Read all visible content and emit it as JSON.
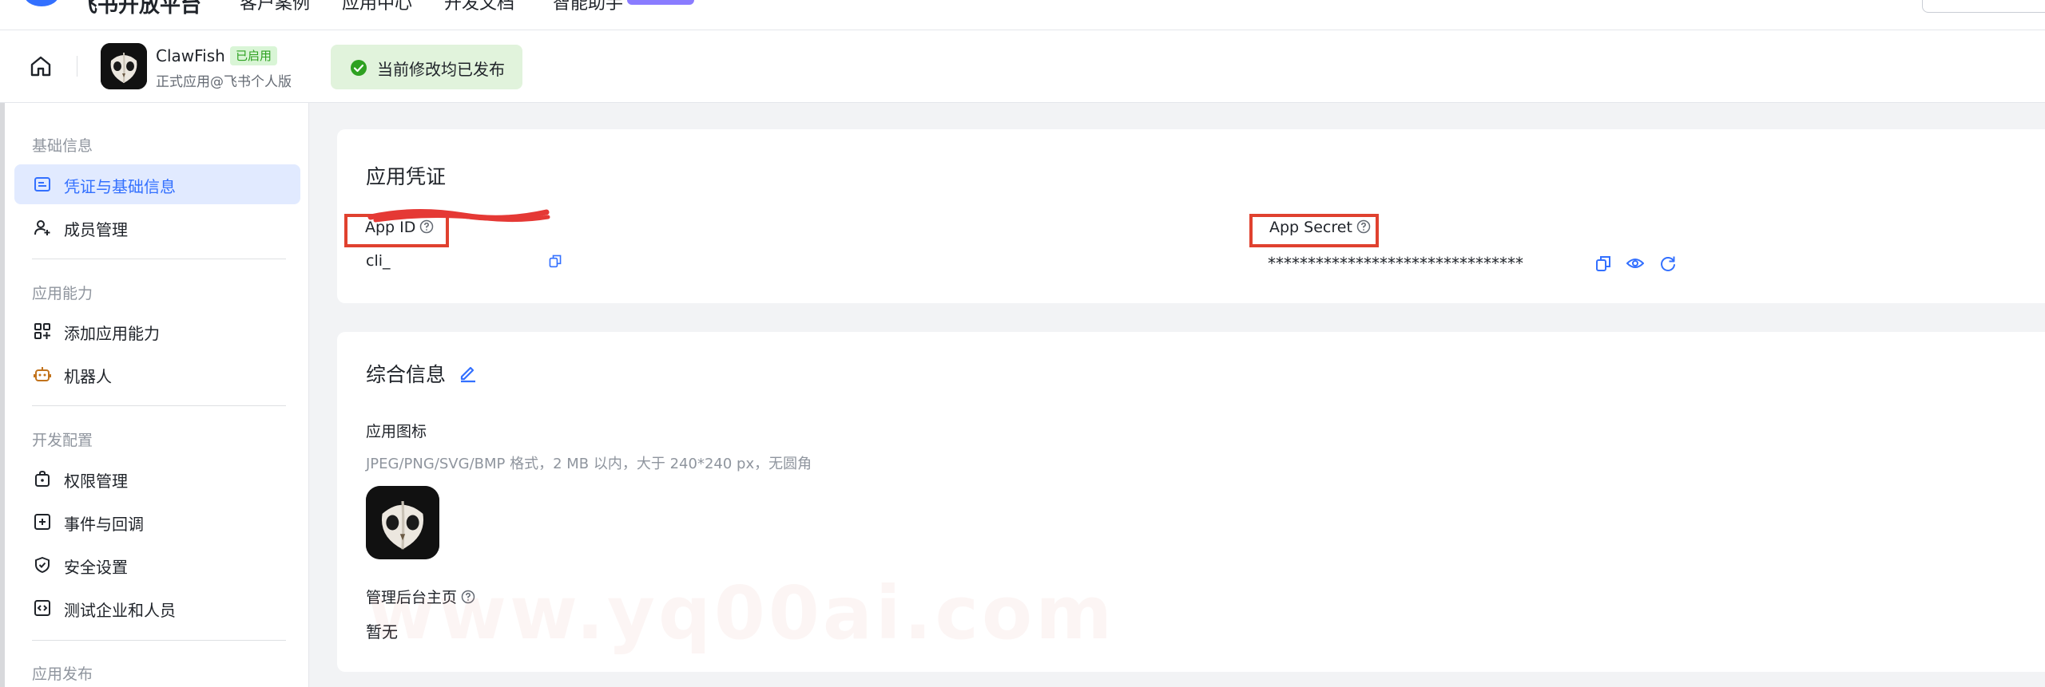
{
  "topnav": {
    "brand": "飞书开放平台",
    "items": [
      "客户案例",
      "应用中心",
      "开发文档",
      "智能助手"
    ]
  },
  "header": {
    "app_name": "ClawFish",
    "status": "已启用",
    "subtitle": "正式应用@飞书个人版",
    "publish_note": "当前修改均已发布"
  },
  "sidebar": {
    "sections": [
      {
        "title": "基础信息",
        "items": [
          {
            "label": "凭证与基础信息",
            "icon": "id-card-icon",
            "active": true
          },
          {
            "label": "成员管理",
            "icon": "user-add-icon"
          }
        ]
      },
      {
        "title": "应用能力",
        "items": [
          {
            "label": "添加应用能力",
            "icon": "grid-add-icon"
          },
          {
            "label": "机器人",
            "icon": "robot-icon"
          }
        ]
      },
      {
        "title": "开发配置",
        "items": [
          {
            "label": "权限管理",
            "icon": "lock-icon"
          },
          {
            "label": "事件与回调",
            "icon": "event-icon"
          },
          {
            "label": "安全设置",
            "icon": "shield-icon"
          },
          {
            "label": "测试企业和人员",
            "icon": "code-icon"
          }
        ]
      },
      {
        "title": "应用发布",
        "items": []
      }
    ]
  },
  "credentials": {
    "title": "应用凭证",
    "app_id_label": "App ID",
    "app_id_value": "cli_",
    "app_secret_label": "App Secret",
    "app_secret_value": "********************************"
  },
  "general": {
    "title": "综合信息",
    "icon_label": "应用图标",
    "icon_hint": "JPEG/PNG/SVG/BMP 格式，2 MB 以内，大于 240*240 px，无圆角",
    "admin_home_label": "管理后台主页",
    "admin_home_value": "暂无"
  },
  "watermark": "www.yq00ai.com",
  "colors": {
    "accent": "#3370ff",
    "success": "#2ea121",
    "highlight_box": "#e0412f"
  }
}
